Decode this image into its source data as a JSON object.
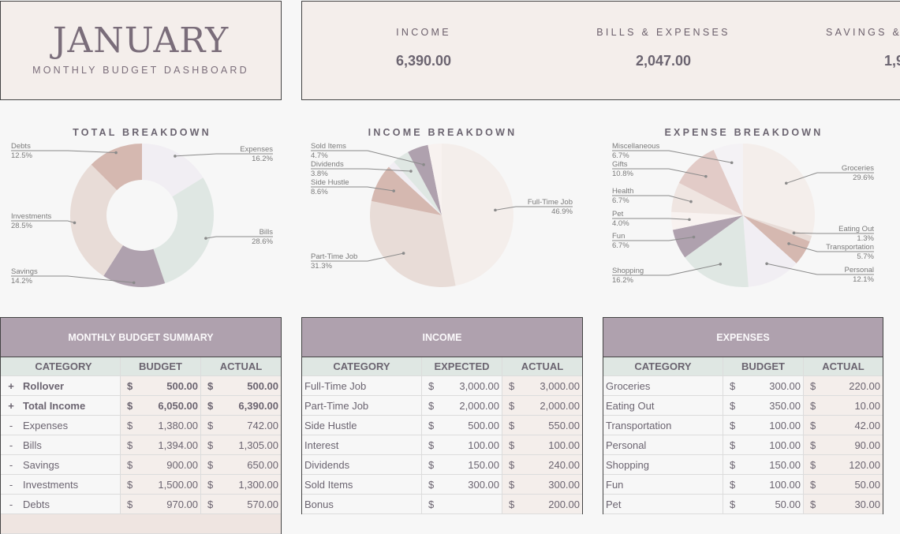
{
  "header": {
    "month": "JANUARY",
    "subtitle": "MONTHLY BUDGET DASHBOARD"
  },
  "stats": [
    {
      "label": "INCOME",
      "value": "6,390.00"
    },
    {
      "label": "BILLS & EXPENSES",
      "value": "2,047.00"
    },
    {
      "label": "SAVINGS &",
      "value": "1,9"
    }
  ],
  "colors": {
    "header_bg": "#afa1ae",
    "colhead_bg": "#dfe7e3",
    "panel_bg": "#f4eeeb",
    "page_bg": "#f7f7f7",
    "text": "#6b6470"
  },
  "chart_data": [
    {
      "type": "pie",
      "subtype": "donut",
      "title": "TOTAL BREAKDOWN",
      "categories": [
        "Expenses",
        "Bills",
        "Savings",
        "Investments",
        "Debts"
      ],
      "values": [
        16.2,
        28.6,
        14.2,
        28.5,
        12.5
      ],
      "labels": [
        "16.2%",
        "28.6%",
        "14.2%",
        "28.5%",
        "12.5%"
      ],
      "colors": [
        "#f1eef3",
        "#dfe7e3",
        "#afa1ae",
        "#e8dcd7",
        "#d5b8b0"
      ]
    },
    {
      "type": "pie",
      "title": "INCOME BREAKDOWN",
      "categories": [
        "Full-Time Job",
        "Part-Time Job",
        "Side Hustle",
        "Interest",
        "Dividends",
        "Sold Items",
        "Bonus"
      ],
      "values": [
        46.9,
        31.3,
        8.6,
        1.6,
        3.8,
        4.7,
        3.1
      ],
      "labels": [
        "46.9%",
        "31.3%",
        "8.6%",
        "",
        "3.8%",
        "4.7%",
        ""
      ],
      "colors": [
        "#f4eeeb",
        "#e8dcd7",
        "#d5b8b0",
        "#f1eef3",
        "#dfe7e3",
        "#afa1ae",
        "#f8f2f0"
      ]
    },
    {
      "type": "pie",
      "title": "EXPENSE BREAKDOWN",
      "categories": [
        "Groceries",
        "Eating Out",
        "Transportation",
        "Personal",
        "Shopping",
        "Fun",
        "Pet",
        "Health",
        "Gifts",
        "Miscellaneous"
      ],
      "values": [
        29.6,
        1.3,
        5.7,
        12.1,
        16.2,
        6.7,
        4.0,
        6.7,
        10.8,
        6.7
      ],
      "labels": [
        "29.6%",
        "1.3%",
        "5.7%",
        "12.1%",
        "16.2%",
        "6.7%",
        "4.0%",
        "6.7%",
        "10.8%",
        "6.7%"
      ],
      "colors": [
        "#f4eeeb",
        "#e8dcd7",
        "#d5b8b0",
        "#f1eef3",
        "#dfe7e3",
        "#afa1ae",
        "#f8f2f0",
        "#efe5e1",
        "#e2cbc7",
        "#f4f2f5"
      ]
    }
  ],
  "summary": {
    "title": "MONTHLY BUDGET SUMMARY",
    "columns": [
      "CATEGORY",
      "BUDGET",
      "ACTUAL"
    ],
    "currency": "$",
    "rows": [
      {
        "sign": "+",
        "category": "Rollover",
        "budget": "500.00",
        "actual": "500.00",
        "bold": true
      },
      {
        "sign": "+",
        "category": "Total Income",
        "budget": "6,050.00",
        "actual": "6,390.00",
        "bold": true
      },
      {
        "sign": "-",
        "category": "Expenses",
        "budget": "1,380.00",
        "actual": "742.00",
        "bold": false
      },
      {
        "sign": "-",
        "category": "Bills",
        "budget": "1,394.00",
        "actual": "1,305.00",
        "bold": false
      },
      {
        "sign": "-",
        "category": "Savings",
        "budget": "900.00",
        "actual": "650.00",
        "bold": false
      },
      {
        "sign": "-",
        "category": "Investments",
        "budget": "1,500.00",
        "actual": "1,300.00",
        "bold": false
      },
      {
        "sign": "-",
        "category": "Debts",
        "budget": "970.00",
        "actual": "570.00",
        "bold": false
      }
    ]
  },
  "income": {
    "title": "INCOME",
    "columns": [
      "CATEGORY",
      "EXPECTED",
      "ACTUAL"
    ],
    "currency": "$",
    "rows": [
      {
        "category": "Full-Time Job",
        "expected": "3,000.00",
        "actual": "3,000.00"
      },
      {
        "category": "Part-Time Job",
        "expected": "2,000.00",
        "actual": "2,000.00"
      },
      {
        "category": "Side Hustle",
        "expected": "500.00",
        "actual": "550.00"
      },
      {
        "category": "Interest",
        "expected": "100.00",
        "actual": "100.00"
      },
      {
        "category": "Dividends",
        "expected": "150.00",
        "actual": "240.00"
      },
      {
        "category": "Sold Items",
        "expected": "300.00",
        "actual": "300.00"
      },
      {
        "category": "Bonus",
        "expected": "",
        "actual": "200.00"
      }
    ]
  },
  "expenses": {
    "title": "EXPENSES",
    "columns": [
      "CATEGORY",
      "BUDGET",
      "ACTUAL"
    ],
    "currency": "$",
    "rows": [
      {
        "category": "Groceries",
        "budget": "300.00",
        "actual": "220.00"
      },
      {
        "category": "Eating Out",
        "budget": "350.00",
        "actual": "10.00"
      },
      {
        "category": "Transportation",
        "budget": "100.00",
        "actual": "42.00"
      },
      {
        "category": "Personal",
        "budget": "100.00",
        "actual": "90.00"
      },
      {
        "category": "Shopping",
        "budget": "150.00",
        "actual": "120.00"
      },
      {
        "category": "Fun",
        "budget": "100.00",
        "actual": "50.00"
      },
      {
        "category": "Pet",
        "budget": "50.00",
        "actual": "30.00"
      }
    ]
  }
}
